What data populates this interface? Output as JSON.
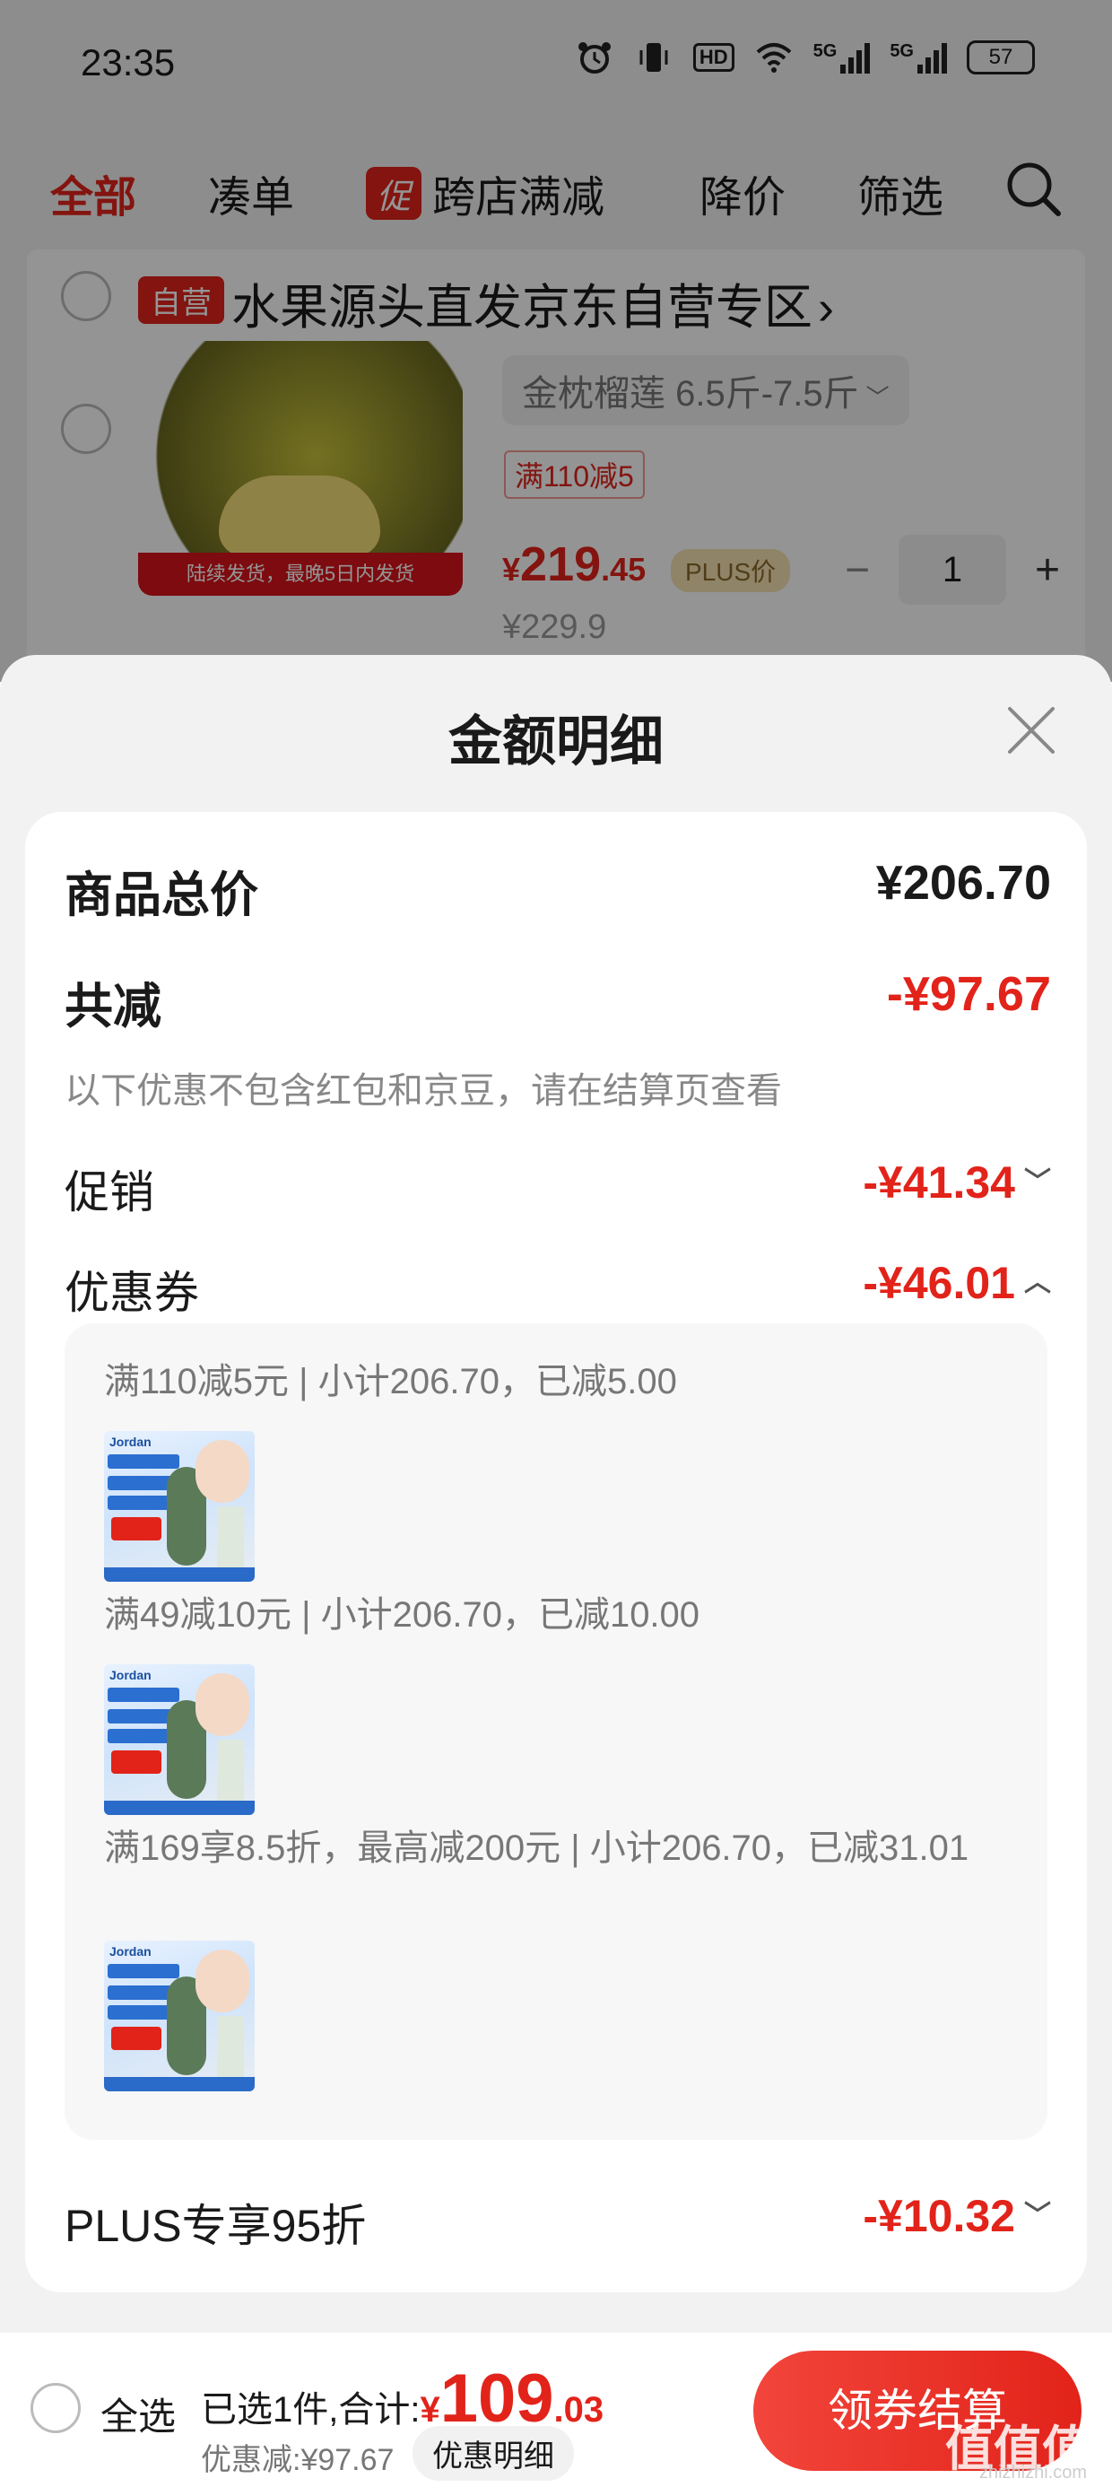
{
  "status_bar": {
    "time": "23:35",
    "network_label": "HD",
    "sim1": "5G",
    "sim2": "5G",
    "battery": "57",
    "icons": [
      "alarm-icon",
      "vibrate-icon",
      "hd-icon",
      "wifi-icon",
      "signal-icon",
      "signal-icon",
      "battery-icon"
    ]
  },
  "top_nav": {
    "tabs": [
      {
        "label": "全部",
        "active": true
      },
      {
        "label": "凑单",
        "active": false
      },
      {
        "label": "跨店满减",
        "active": false,
        "tag": "促"
      },
      {
        "label": "降价",
        "active": false
      },
      {
        "label": "筛选",
        "active": false
      }
    ],
    "search_icon": "search-icon"
  },
  "store": {
    "tag": "自营",
    "name": "水果源头直发京东自营专区",
    "chevron": "›",
    "product": {
      "spec": "金枕榴莲 6.5斤-7.5斤",
      "image_banner": "陆续发货，最晚5日内发货",
      "coupon": "满110减5",
      "price_currency": "¥",
      "price_int": "219",
      "price_dec": ".45",
      "plus_label": "PLUS价",
      "original_price": "¥229.9",
      "quantity": "1",
      "minus": "−",
      "plus": "+"
    }
  },
  "sheet": {
    "title": "金额明细",
    "rows": {
      "total_label": "商品总价",
      "total_value": "¥206.70",
      "reduce_label": "共减",
      "reduce_value": "-¥97.67",
      "note": "以下优惠不包含红包和京豆，请在结算页查看",
      "promo_label": "促销",
      "promo_value": "-¥41.34",
      "coupon_label": "优惠券",
      "coupon_value": "-¥46.01",
      "plus_label": "PLUS专享95折",
      "plus_value": "-¥10.32"
    },
    "coupons": [
      {
        "text": "满110减5元 | 小计206.70，已减5.00"
      },
      {
        "text": "满49减10元 | 小计206.70，已减10.00"
      },
      {
        "text": "满169享8.5折，最高减200元 | 小计206.70，已减31.01"
      }
    ],
    "coupon_image_brand": "Jordan"
  },
  "bottom_bar": {
    "select_all": "全选",
    "summary": "已选1件,合计:",
    "currency": "¥",
    "amount_int": "109",
    "amount_dec": ".03",
    "discount": "优惠减:¥97.67",
    "detail_button": "优惠明细",
    "checkout": "领券结算"
  },
  "watermark": {
    "main": "值值值",
    "sub": "zhizhizhi.com"
  },
  "colors": {
    "accent": "#e2231a",
    "plus_gold": "#f6e3b4"
  }
}
